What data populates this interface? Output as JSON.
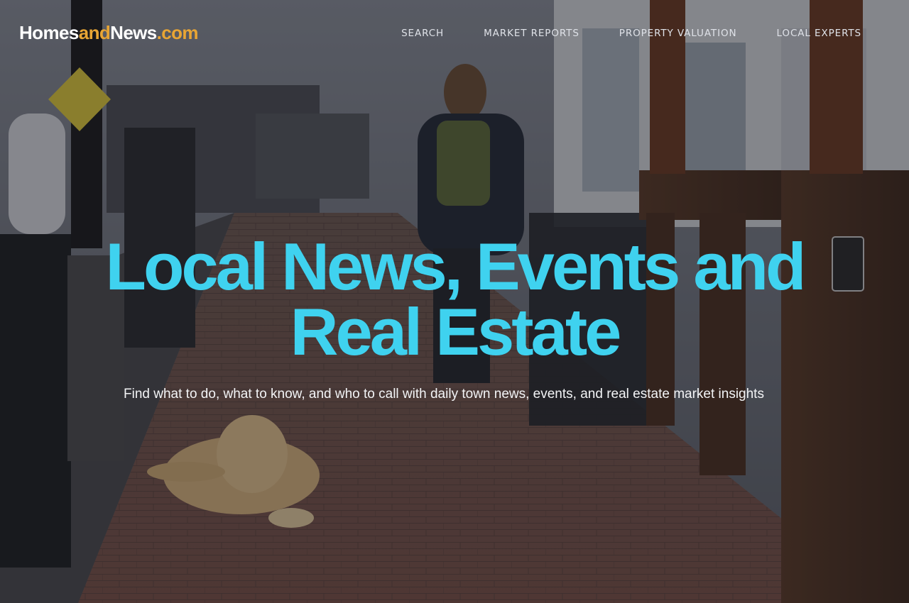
{
  "brand": {
    "part1": "Homes",
    "part2": "and",
    "part3": "News",
    "part4": ".com",
    "text_color": "#ffffff",
    "accent_color": "#e8a534"
  },
  "nav": {
    "items": [
      {
        "label": "SEARCH"
      },
      {
        "label": "MARKET REPORTS"
      },
      {
        "label": "PROPERTY VALUATION"
      },
      {
        "label": "LOCAL EXPERTS"
      }
    ]
  },
  "hero": {
    "title_line1": "Local News, Events and",
    "title_line2": "Real Estate",
    "subtitle": "Find what to do, what to know, and who to call with daily town news, events, and real estate market insights",
    "title_color": "#3fd2ef"
  },
  "background": {
    "description_icon": "street-photo"
  }
}
